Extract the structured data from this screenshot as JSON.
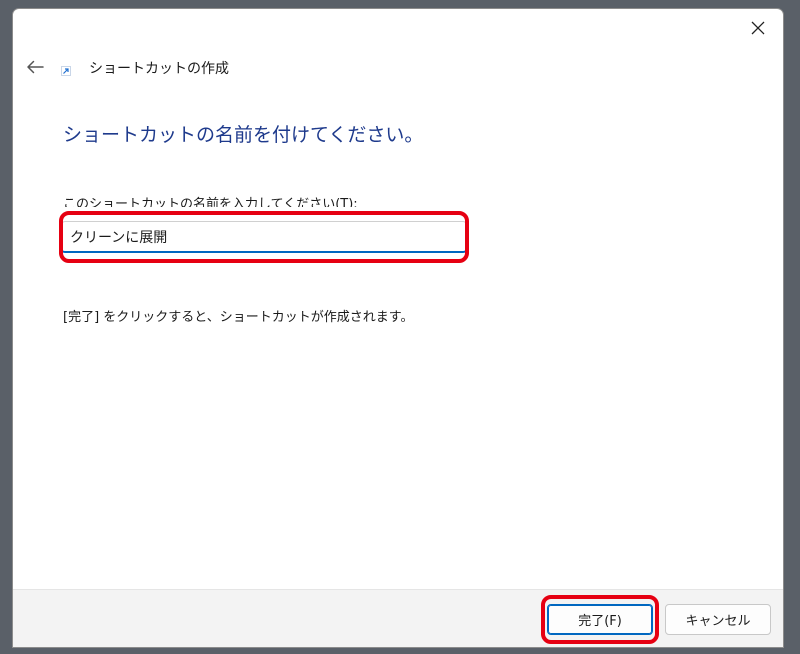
{
  "window": {
    "close_icon": "close-icon",
    "back_icon": "arrow-left-icon",
    "app_icon": "shortcut-icon"
  },
  "header": {
    "wizard_title": "ショートカットの作成"
  },
  "main": {
    "heading": "ショートカットの名前を付けてください。",
    "field_label": "このショートカットの名前を入力してください(T):",
    "name_value": "クリーンに展開",
    "info_text": "[完了] をクリックすると、ショートカットが作成されます。"
  },
  "footer": {
    "finish_label": "完了(F)",
    "cancel_label": "キャンセル"
  },
  "colors": {
    "heading": "#1e3a8c",
    "accent": "#0067c0",
    "highlight": "#e60012"
  }
}
